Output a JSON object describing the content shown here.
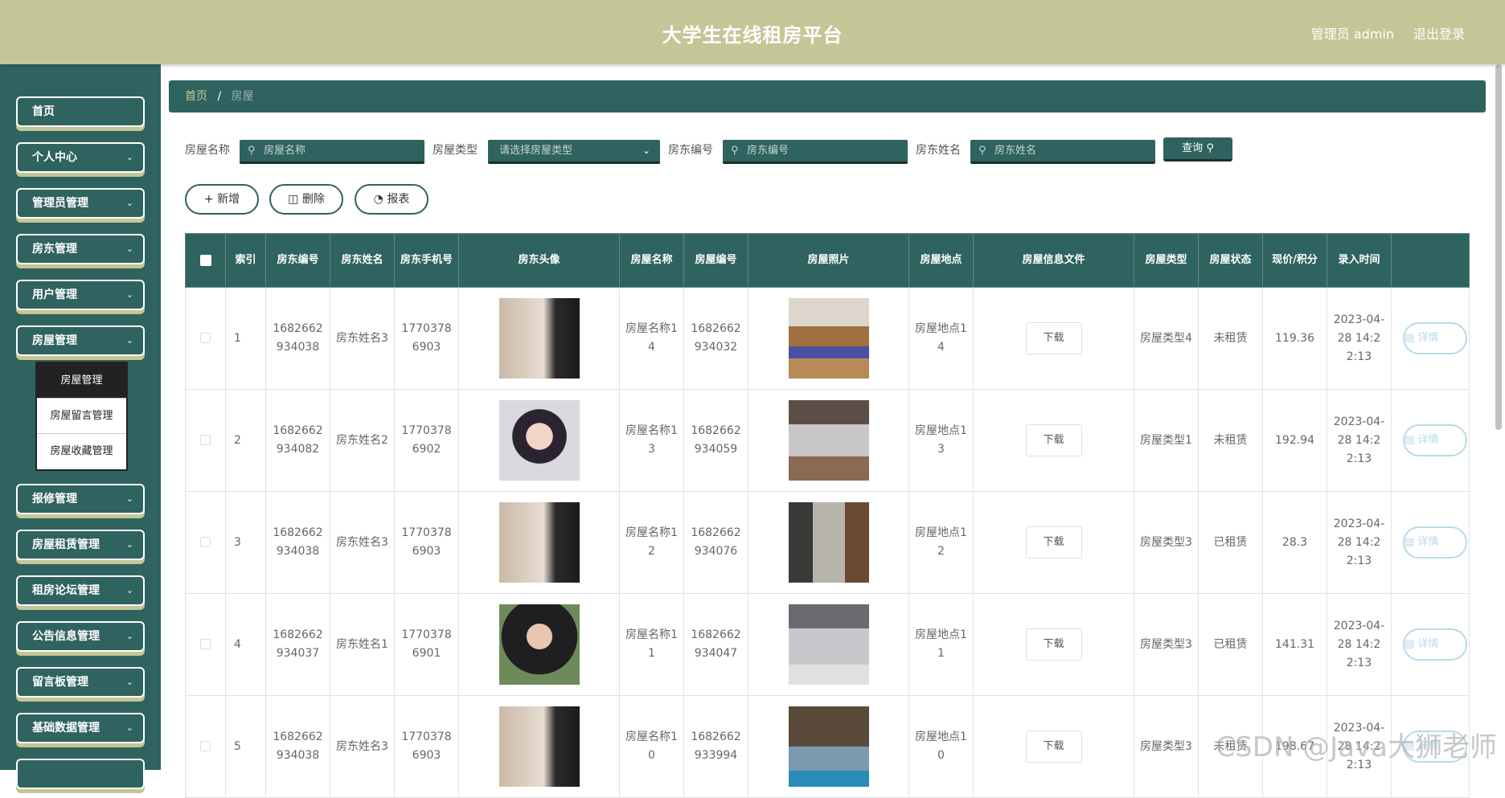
{
  "header": {
    "title": "大学生在线租房平台",
    "user": "管理员 admin",
    "logout": "退出登录"
  },
  "sidebar": {
    "items": [
      {
        "label": "首页",
        "arrow": false
      },
      {
        "label": "个人中心",
        "arrow": true
      },
      {
        "label": "管理员管理",
        "arrow": true
      },
      {
        "label": "房东管理",
        "arrow": true
      },
      {
        "label": "用户管理",
        "arrow": true
      },
      {
        "label": "房屋管理",
        "arrow": true
      },
      {
        "label": "报修管理",
        "arrow": true
      },
      {
        "label": "房屋租赁管理",
        "arrow": true
      },
      {
        "label": "租房论坛管理",
        "arrow": true
      },
      {
        "label": "公告信息管理",
        "arrow": true
      },
      {
        "label": "留言板管理",
        "arrow": true
      },
      {
        "label": "基础数据管理",
        "arrow": true
      }
    ],
    "submenu": [
      "房屋管理",
      "房屋留言管理",
      "房屋收藏管理"
    ]
  },
  "breadcrumb": {
    "home": "首页",
    "sep": "/",
    "current": "房屋"
  },
  "search": {
    "house_name_label": "房屋名称",
    "house_name_placeholder": "房屋名称",
    "house_type_label": "房屋类型",
    "house_type_placeholder": "请选择房屋类型",
    "landlord_no_label": "房东编号",
    "landlord_no_placeholder": "房东编号",
    "landlord_name_label": "房东姓名",
    "landlord_name_placeholder": "房东姓名",
    "query_label": "查询"
  },
  "actions": {
    "add": "新增",
    "delete": "删除",
    "report": "报表"
  },
  "table": {
    "headers": [
      "",
      "索引",
      "房东编号",
      "房东姓名",
      "房东手机号",
      "房东头像",
      "房屋名称",
      "房屋编号",
      "房屋照片",
      "房屋地点",
      "房屋信息文件",
      "房屋类型",
      "房屋状态",
      "现价/积分",
      "录入时间",
      ""
    ],
    "download_label": "下载",
    "detail_label": "详情",
    "rows": [
      {
        "idx": "1",
        "landlord_no": "1682662934038",
        "landlord_name": "房东姓名3",
        "phone": "17703786903",
        "house_name": "房屋名称14",
        "house_no": "1682662934032",
        "location": "房屋地点14",
        "type": "房屋类型4",
        "status": "未租赁",
        "price": "119.36",
        "time": "2023-04-28 14:22:13"
      },
      {
        "idx": "2",
        "landlord_no": "1682662934082",
        "landlord_name": "房东姓名2",
        "phone": "17703786902",
        "house_name": "房屋名称13",
        "house_no": "1682662934059",
        "location": "房屋地点13",
        "type": "房屋类型1",
        "status": "未租赁",
        "price": "192.94",
        "time": "2023-04-28 14:22:13"
      },
      {
        "idx": "3",
        "landlord_no": "1682662934038",
        "landlord_name": "房东姓名3",
        "phone": "17703786903",
        "house_name": "房屋名称12",
        "house_no": "1682662934076",
        "location": "房屋地点12",
        "type": "房屋类型3",
        "status": "已租赁",
        "price": "28.3",
        "time": "2023-04-28 14:22:13"
      },
      {
        "idx": "4",
        "landlord_no": "1682662934037",
        "landlord_name": "房东姓名1",
        "phone": "17703786901",
        "house_name": "房屋名称11",
        "house_no": "1682662934047",
        "location": "房屋地点11",
        "type": "房屋类型3",
        "status": "已租赁",
        "price": "141.31",
        "time": "2023-04-28 14:22:13"
      },
      {
        "idx": "5",
        "landlord_no": "1682662934038",
        "landlord_name": "房东姓名3",
        "phone": "17703786903",
        "house_name": "房屋名称10",
        "house_no": "1682662933994",
        "location": "房屋地点10",
        "type": "房屋类型3",
        "status": "未租赁",
        "price": "198.67",
        "time": "2023-04-28 14:22:13"
      }
    ]
  },
  "watermark": "CSDN @Java大狮老师"
}
